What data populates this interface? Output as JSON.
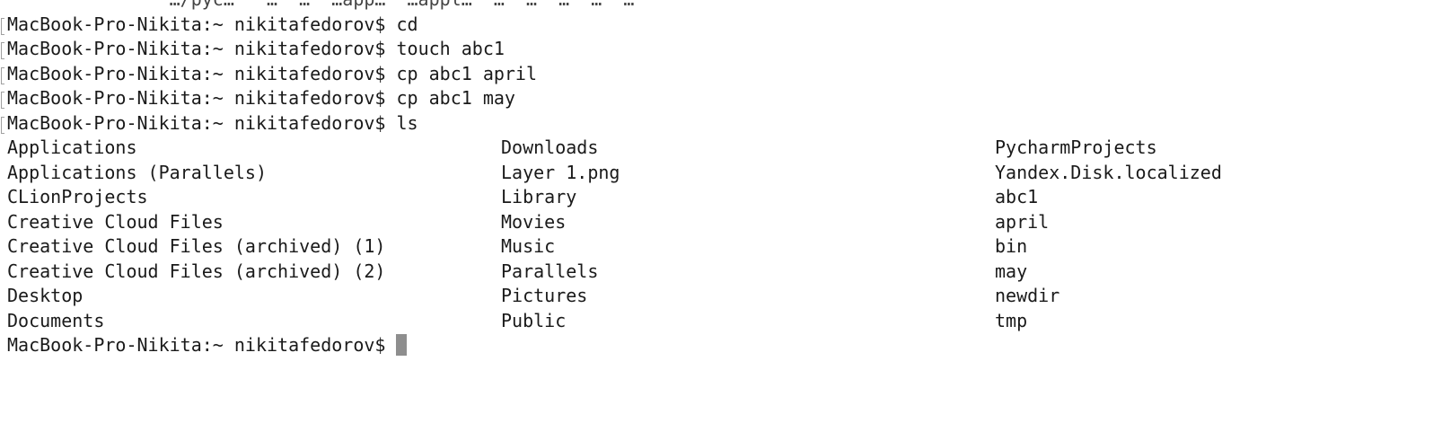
{
  "terminal": {
    "partial_top_line": "               …/pyc…   …  …  …app…  …appl…  …  …  …  …  …",
    "history": [
      {
        "prompt": "MacBook-Pro-Nikita:~ nikitafedorov$",
        "command": "cd"
      },
      {
        "prompt": "MacBook-Pro-Nikita:~ nikitafedorov$",
        "command": "touch abc1"
      },
      {
        "prompt": "MacBook-Pro-Nikita:~ nikitafedorov$",
        "command": "cp abc1 april"
      },
      {
        "prompt": "MacBook-Pro-Nikita:~ nikitafedorov$",
        "command": "cp abc1 may"
      },
      {
        "prompt": "MacBook-Pro-Nikita:~ nikitafedorov$",
        "command": "ls"
      }
    ],
    "ls_output": [
      [
        "Applications",
        "Downloads",
        "PycharmProjects"
      ],
      [
        "Applications (Parallels)",
        "Layer 1.png",
        "Yandex.Disk.localized"
      ],
      [
        "CLionProjects",
        "Library",
        "abc1"
      ],
      [
        "Creative Cloud Files",
        "Movies",
        "april"
      ],
      [
        "Creative Cloud Files (archived) (1)",
        "Music",
        "bin"
      ],
      [
        "Creative Cloud Files (archived) (2)",
        "Parallels",
        "may"
      ],
      [
        "Desktop",
        "Pictures",
        "newdir"
      ],
      [
        "Documents",
        "Public",
        "tmp"
      ]
    ],
    "current_prompt": "MacBook-Pro-Nikita:~ nikitafedorov$"
  }
}
